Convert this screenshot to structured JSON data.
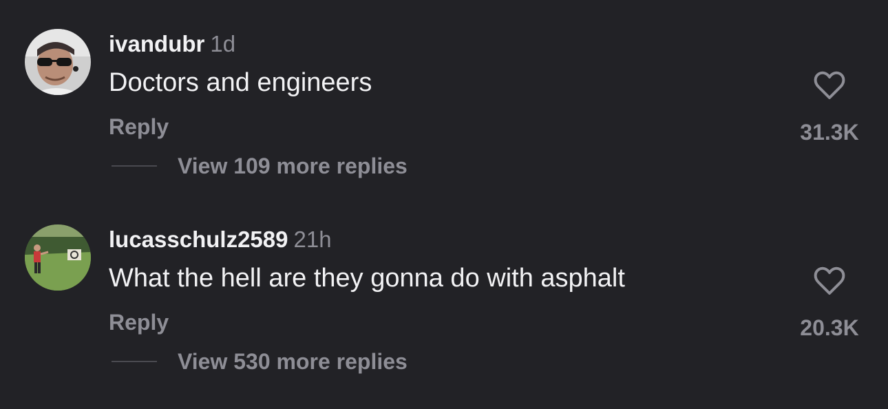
{
  "comments": [
    {
      "username": "ivandubr",
      "time": "1d",
      "text": "Doctors and engineers",
      "reply_label": "Reply",
      "view_replies": "View 109 more replies",
      "like_count": "31.3K",
      "avatar_icon": "avatar-photo-sunglasses"
    },
    {
      "username": "lucasschulz2589",
      "time": "21h",
      "text": "What the hell are they gonna do with asphalt",
      "reply_label": "Reply",
      "view_replies": "View 530 more replies",
      "like_count": "20.3K",
      "avatar_icon": "avatar-photo-archery"
    }
  ],
  "icons": {
    "like": "heart-icon"
  },
  "colors": {
    "background": "#222226",
    "primary_text": "#f2f2f4",
    "secondary_text": "#8e8e96"
  }
}
